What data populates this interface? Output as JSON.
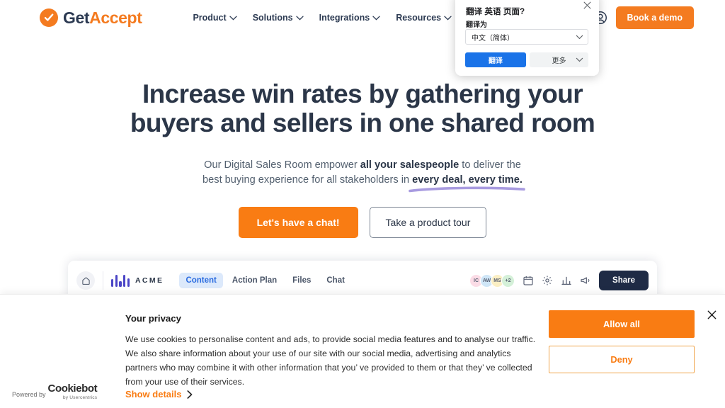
{
  "header": {
    "logo": {
      "part1": "Get",
      "part2": "Accept"
    },
    "nav": [
      {
        "label": "Product"
      },
      {
        "label": "Solutions"
      },
      {
        "label": "Integrations"
      },
      {
        "label": "Resources"
      }
    ],
    "demo_button": "Book a demo"
  },
  "hero": {
    "title_line1": "Increase win rates by gathering your",
    "title_line2": "buyers and sellers in one shared room",
    "sub_line1_pre": "Our Digital Sales Room empower ",
    "sub_line1_bold": "all your salespeople",
    "sub_line1_post": " to deliver the",
    "sub_line2_pre": "best buying experience for all stakeholders in ",
    "sub_line2_bold": "every deal, every time.",
    "cta_primary": "Let's have a chat!",
    "cta_secondary": "Take a product tour"
  },
  "app_mock": {
    "brand": "ACME",
    "tabs": [
      {
        "label": "Content",
        "active": true
      },
      {
        "label": "Action Plan",
        "active": false
      },
      {
        "label": "Files",
        "active": false
      },
      {
        "label": "Chat",
        "active": false
      }
    ],
    "avatars": [
      {
        "initials": "IC",
        "color": "#FBDCE6"
      },
      {
        "initials": "AW",
        "color": "#CFE6F7"
      },
      {
        "initials": "MS",
        "color": "#FBEFC4"
      },
      {
        "initials": "+2",
        "color": "#D4F0D8"
      }
    ],
    "share_button": "Share"
  },
  "cookie_banner": {
    "title": "Your privacy",
    "text": "We use cookies to personalise content and ads, to provide social media features and to analyse our traffic. We also share information about your use of our site with our social media, advertising and analytics partners who may combine it with other information that you’ ve provided to them or that they’ ve collected from your use of their services.",
    "allow_button": "Allow all",
    "deny_button": "Deny",
    "powered_by": "Powered by",
    "cookiebot_name": "Cookiebot",
    "cookiebot_sub": "by Usercentrics",
    "show_details": "Show details"
  },
  "translate_popup": {
    "title": "翻译 英语 页面?",
    "label": "翻译为",
    "selected_language": "中文（简体）",
    "translate_button": "翻译",
    "more_button": "更多"
  },
  "colors": {
    "brand_orange": "#F47B20",
    "cta_orange": "#F97C13",
    "navy": "#2B3648",
    "share_dark": "#1F2B45",
    "tab_active_bg": "#DCE9FB",
    "tab_active_fg": "#2B6CE0",
    "acme_purple": "#4B45C6",
    "underline_purple": "#A89BE0",
    "translate_blue": "#1A73E8"
  }
}
